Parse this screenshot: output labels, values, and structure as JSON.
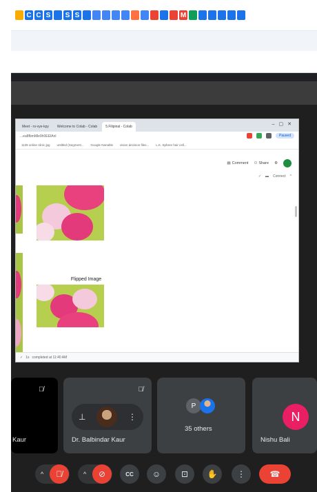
{
  "bookmarks": [
    {
      "color": "#f9ab00",
      "glyph": ""
    },
    {
      "color": "#1a73e8",
      "glyph": "C"
    },
    {
      "color": "#1a73e8",
      "glyph": "C"
    },
    {
      "color": "#1a73e8",
      "glyph": "S"
    },
    {
      "color": "#1a73e8",
      "glyph": ""
    },
    {
      "color": "#1a73e8",
      "glyph": "S"
    },
    {
      "color": "#1a73e8",
      "glyph": "S"
    },
    {
      "color": "#1a73e8",
      "glyph": ""
    },
    {
      "color": "#4285f4",
      "glyph": ""
    },
    {
      "color": "#4285f4",
      "glyph": ""
    },
    {
      "color": "#4285f4",
      "glyph": ""
    },
    {
      "color": "#4285f4",
      "glyph": ""
    },
    {
      "color": "#ff7043",
      "glyph": ""
    },
    {
      "color": "#4285f4",
      "glyph": ""
    },
    {
      "color": "#ea4335",
      "glyph": ""
    },
    {
      "color": "#1a73e8",
      "glyph": ""
    },
    {
      "color": "#ea4335",
      "glyph": ""
    },
    {
      "color": "#ea4335",
      "glyph": "M"
    },
    {
      "color": "#0f9d58",
      "glyph": ""
    },
    {
      "color": "#1a73e8",
      "glyph": ""
    },
    {
      "color": "#1a73e8",
      "glyph": ""
    },
    {
      "color": "#1a73e8",
      "glyph": ""
    },
    {
      "color": "#1a73e8",
      "glyph": ""
    },
    {
      "color": "#1a73e8",
      "glyph": ""
    }
  ],
  "shared_screen": {
    "tabs": [
      "Meet - ro-vye-kpy",
      "Welcome to Colab - Colab",
      "5.Filipinal - Colab"
    ],
    "url": "...ea8fbmMle9h0EEIAnl",
    "profile": "Paused",
    "bookmarks": [
      "1135 online clinic jpg",
      "untitled (Segment...",
      "Google Nanable",
      "vision decision files...",
      "L.K. Sphere hair cell..."
    ],
    "comment": "Comment",
    "share": "Share",
    "status_label": "Connect",
    "flipped_label": "Flipped Image",
    "footer_status": "completed at 11:40 AM",
    "footer_time": "1s"
  },
  "participants": {
    "tile1_name": "Kaur",
    "tile2_name": "Dr. Balbindar Kaur",
    "tile3_initial": "P",
    "tile3_name": "35 others",
    "tile4_initial": "N",
    "tile4_name": "Nishu Bali"
  },
  "controls": {
    "chevron": "^",
    "mic_icon": "mic-off",
    "camera_icon": "camera-off",
    "captions_label": "CC",
    "end_call_icon": "phone-hangup"
  },
  "colors": {
    "accent_red": "#ea4335",
    "tile_bg": "#3c4043",
    "avatar_pink": "#e91e63"
  }
}
